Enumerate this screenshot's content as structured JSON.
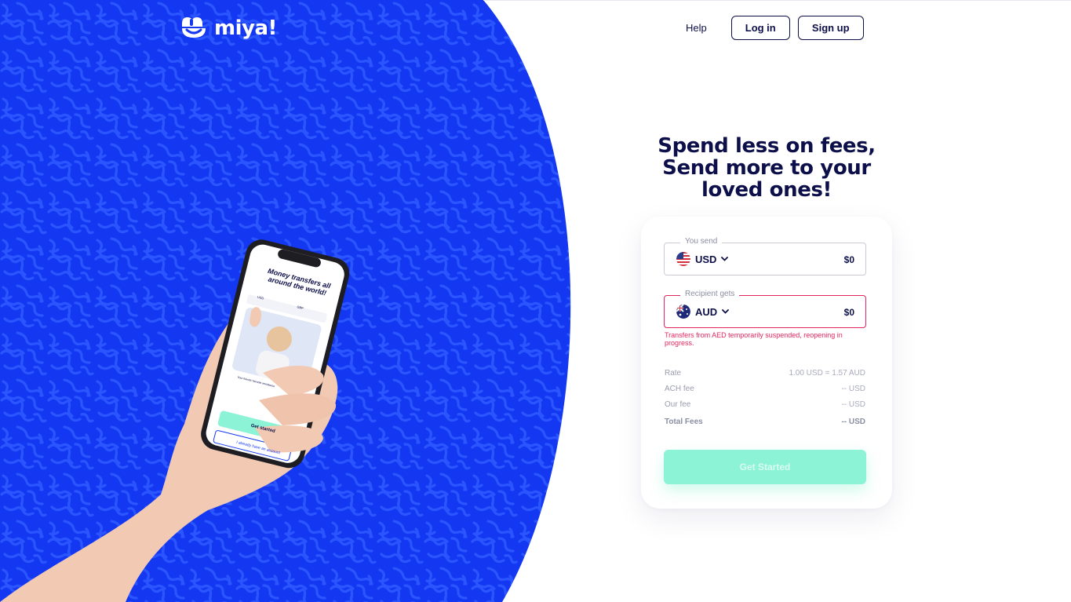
{
  "brand": {
    "name": "miya!",
    "primary_color": "#1135f5",
    "accent_color": "#8cf3d6",
    "error_color": "#e2245f",
    "text_color": "#0d0f4a"
  },
  "nav": {
    "help": "Help",
    "login": "Log in",
    "signup": "Sign up"
  },
  "hero": {
    "headline": [
      "Spend less on fees,",
      "Send more to your",
      "loved ones!"
    ]
  },
  "phone_screen": {
    "title": "Money transfers all around the world!",
    "send_ccy": "USD",
    "recv_ccy": "GBP",
    "caption": "Your friends' favorite remittance",
    "primary_button": "Get started",
    "secondary_button": "I already have an account"
  },
  "converter": {
    "send": {
      "legend": "You send",
      "currency": "USD",
      "amount": "$0",
      "flag_icon": "us-flag-icon"
    },
    "receive": {
      "legend": "Recipient gets",
      "currency": "AUD",
      "amount": "$0",
      "flag_icon": "au-flag-icon"
    },
    "error": "Transfers from AED temporarily suspended, reopening in progress.",
    "rows": [
      {
        "label": "Rate",
        "value": "1.00 USD = 1.57 AUD"
      },
      {
        "label": "ACH fee",
        "value": "-- USD"
      },
      {
        "label": "Our fee",
        "value": "-- USD"
      },
      {
        "label": "Total Fees",
        "value": "-- USD"
      }
    ],
    "cta": "Get Started"
  }
}
